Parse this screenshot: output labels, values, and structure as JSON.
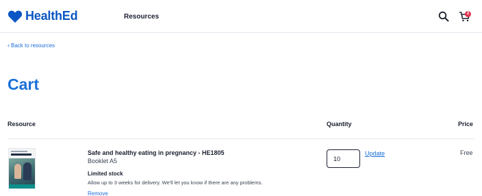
{
  "header": {
    "brand": "HealthEd",
    "nav_resources": "Resources",
    "cart_count": "2",
    "icons": {
      "logo": "heart-logo-icon",
      "search": "search-icon",
      "cart": "cart-icon"
    },
    "brand_color": "#0b56c4",
    "badge_color": "#e0344f"
  },
  "back_link": {
    "label": "Back to resources"
  },
  "page_title": "Cart",
  "table": {
    "headers": {
      "resource": "Resource",
      "quantity": "Quantity",
      "price": "Price"
    },
    "items": [
      {
        "title": "Safe and healthy eating in pregnancy - HE1805",
        "format": "Booklet A5",
        "stock_label": "Limited stock",
        "stock_note": "Allow up to 3 weeks for delivery. We'll let you know if there are any problems.",
        "remove_label": "Remove",
        "quantity": "10",
        "update_label": "Update",
        "price": "Free"
      }
    ]
  },
  "accent_color": "#1a6fd8"
}
